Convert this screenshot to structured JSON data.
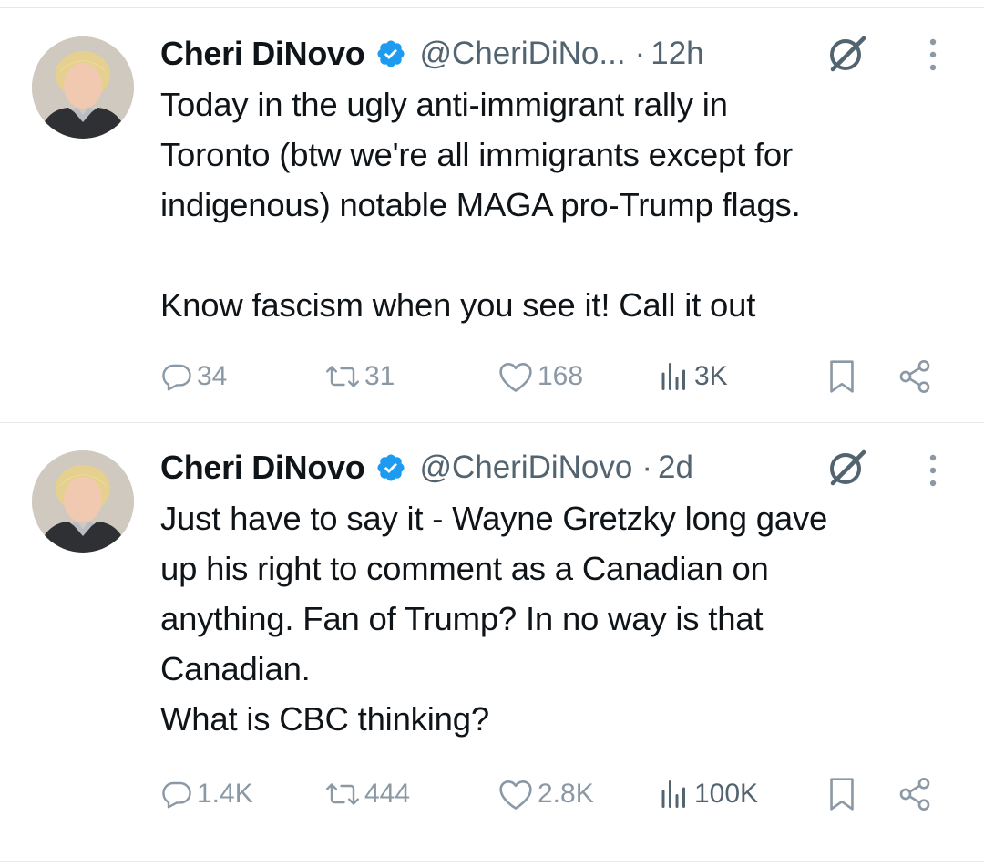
{
  "colors": {
    "verified": "#1d9bf0",
    "muted": "#536471",
    "action_grey": "#8b98a5",
    "divider": "#e6e9ec"
  },
  "tweets": [
    {
      "author_name": "Cheri DiNovo",
      "handle": "@CheriDiNo...",
      "separator": "·",
      "time": "12h",
      "text": "Today in the ugly anti-immigrant rally in\nToronto (btw we're all immigrants except for\nindigenous) notable MAGA pro-Trump flags.\n\nKnow fascism when you see it! Call it out",
      "replies": "34",
      "reposts": "31",
      "likes": "168",
      "views": "3K",
      "icons": [
        "reply-icon",
        "repost-icon",
        "like-icon",
        "views-icon",
        "bookmark-icon",
        "share-icon",
        "grok-icon",
        "more-icon",
        "verified-icon"
      ]
    },
    {
      "author_name": "Cheri DiNovo",
      "handle": "@CheriDiNovo",
      "separator": "·",
      "time": "2d",
      "text": "Just have to say it - Wayne Gretzky long gave\nup his right to comment as a Canadian on\nanything.  Fan of Trump? In no way is that\nCanadian.\nWhat is CBC thinking?",
      "replies": "1.4K",
      "reposts": "444",
      "likes": "2.8K",
      "views": "100K",
      "icons": [
        "reply-icon",
        "repost-icon",
        "like-icon",
        "views-icon",
        "bookmark-icon",
        "share-icon",
        "grok-icon",
        "more-icon",
        "verified-icon"
      ]
    }
  ]
}
